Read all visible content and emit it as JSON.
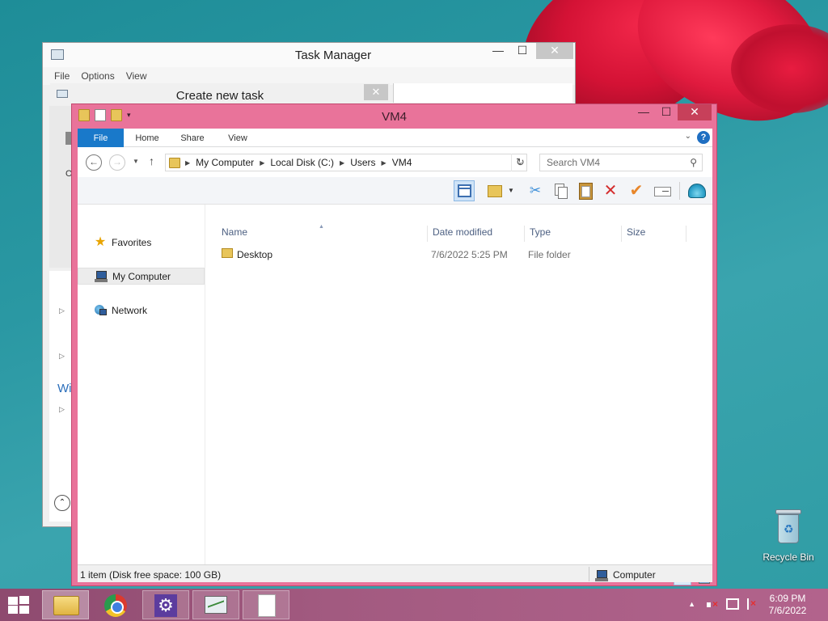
{
  "task_manager": {
    "title": "Task Manager",
    "menu": [
      "File",
      "Options",
      "View"
    ],
    "close_glyph": "✕",
    "left_glyph": "O",
    "partial_text": "Wi"
  },
  "create_task": {
    "title": "Create new task",
    "close_glyph": "✕"
  },
  "explorer": {
    "title": "VM4",
    "ribbon_tabs": [
      "File",
      "Home",
      "Share",
      "View"
    ],
    "address": {
      "crumbs": [
        "My Computer",
        "Local Disk (C:)",
        "Users",
        "VM4"
      ]
    },
    "search_placeholder": "Search VM4",
    "nav_pane": {
      "favorites": "Favorites",
      "my_computer": "My Computer",
      "network": "Network"
    },
    "columns": [
      "Name",
      "Date modified",
      "Type",
      "Size"
    ],
    "files": [
      {
        "name": "Desktop",
        "date_modified": "7/6/2022 5:25 PM",
        "type": "File folder",
        "size": ""
      }
    ],
    "item_count": "1 item",
    "status_bar": {
      "disk_free": "1 item (Disk free space: 100 GB)",
      "zone": "Computer"
    }
  },
  "desktop": {
    "recycle_bin_label": "Recycle Bin"
  },
  "taskbar": {
    "apps": [
      "File Explorer",
      "Google Chrome",
      "Settings",
      "Task Manager",
      "Notepad"
    ],
    "clock": {
      "time": "6:09 PM",
      "date": "7/6/2022"
    }
  }
}
